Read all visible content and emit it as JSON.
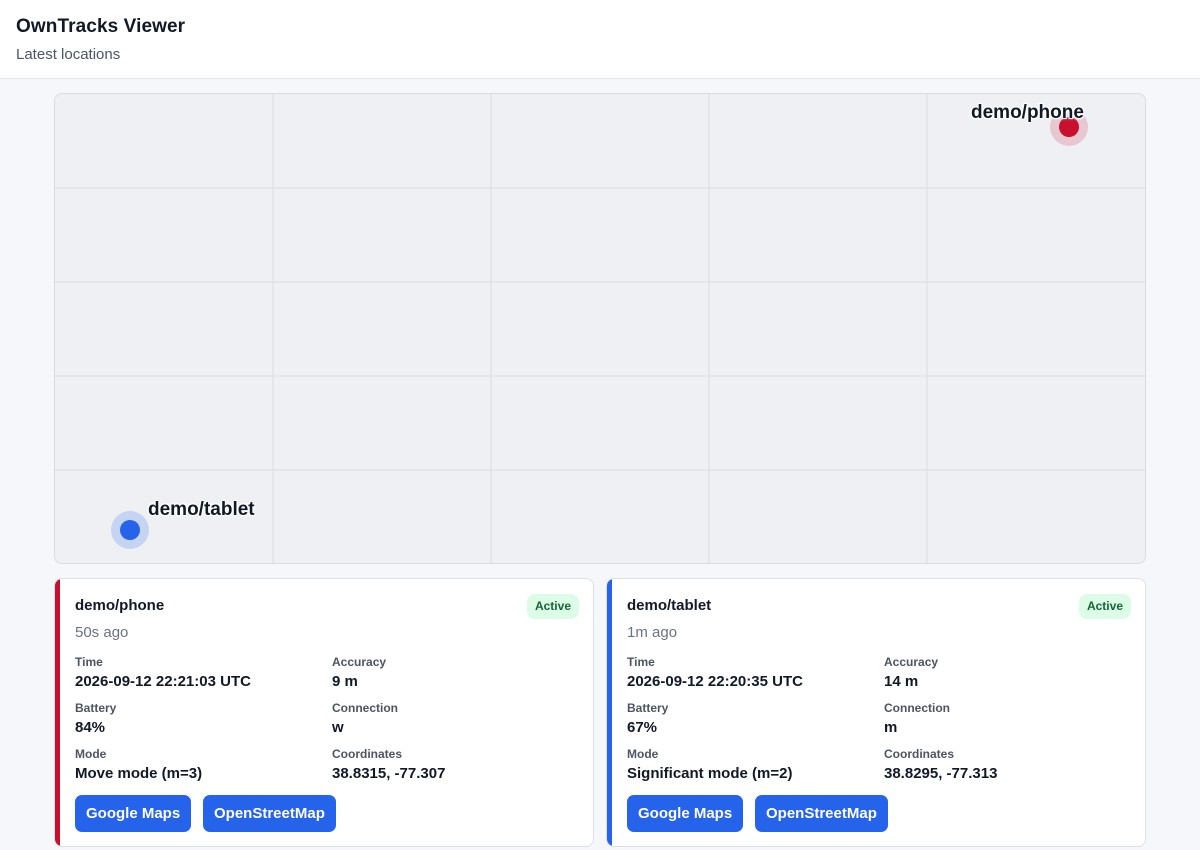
{
  "header": {
    "title": "OwnTracks Viewer",
    "subtitle": "Latest locations"
  },
  "map": {
    "markers": [
      {
        "label": "demo/phone",
        "color": "#c8102e",
        "halo": "rgba(200,16,46,0.18)"
      },
      {
        "label": "demo/tablet",
        "color": "#2563eb",
        "halo": "rgba(37,99,235,0.2)"
      }
    ]
  },
  "devices": [
    {
      "name": "demo/phone",
      "accent_color": "#c8102e",
      "ago": "50s ago",
      "status": "Active",
      "time_label": "Time",
      "time": "2026-09-12 22:21:03 UTC",
      "accuracy_label": "Accuracy",
      "accuracy": "9 m",
      "battery_label": "Battery",
      "battery": "84%",
      "connection_label": "Connection",
      "connection": "w",
      "mode_label": "Mode",
      "mode": "Move mode (m=3)",
      "coords_label": "Coordinates",
      "coords": "38.8315, -77.307",
      "google_label": "Google Maps",
      "osm_label": "OpenStreetMap"
    },
    {
      "name": "demo/tablet",
      "accent_color": "#2563eb",
      "ago": "1m ago",
      "status": "Active",
      "time_label": "Time",
      "time": "2026-09-12 22:20:35 UTC",
      "accuracy_label": "Accuracy",
      "accuracy": "14 m",
      "battery_label": "Battery",
      "battery": "67%",
      "connection_label": "Connection",
      "connection": "m",
      "mode_label": "Mode",
      "mode": "Significant mode (m=2)",
      "coords_label": "Coordinates",
      "coords": "38.8295, -77.313",
      "google_label": "Google Maps",
      "osm_label": "OpenStreetMap"
    }
  ]
}
